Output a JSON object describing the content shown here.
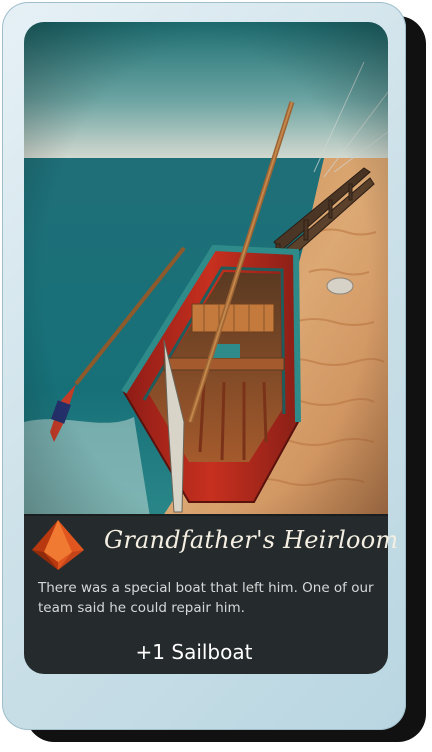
{
  "card": {
    "title": "Grandfather's Heirloom",
    "flavor_text": "There was a special boat that left him. One of our team said he could repair him.",
    "reward": "+1 Sailboat",
    "icon": "orange-pyramid-gem-icon",
    "artwork": "wooden-rowboat-on-beach-illustration"
  },
  "colors": {
    "panel": "#252a2c",
    "frame": "#cfe2ea",
    "boat_hull": "#b8281f",
    "boat_trim": "#2e8b8a",
    "sea": "#1f6f78",
    "sand": "#d9a06b",
    "gem": "#e0561e"
  }
}
